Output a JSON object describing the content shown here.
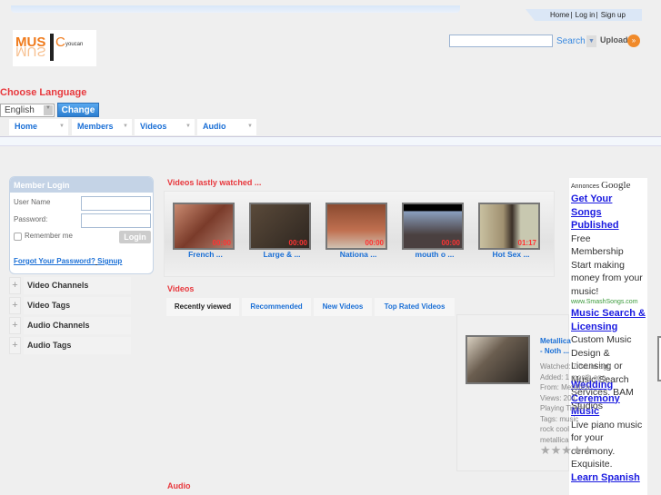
{
  "top_links": [
    "Home",
    "Log in",
    "Sign up"
  ],
  "logo": {
    "text": "MUSIC",
    "sub": "youcan"
  },
  "search": {
    "value": "",
    "button": "Search",
    "upload": "Upload"
  },
  "language": {
    "title": "Choose Language",
    "selected": "English",
    "change": "Change"
  },
  "nav": [
    "Home",
    "Members",
    "Videos",
    "Audio"
  ],
  "login": {
    "title": "Member Login",
    "username": "User Name",
    "password": "Password:",
    "remember": "Remember me",
    "button": "Login",
    "forgot": "Forgot Your Password?",
    "signup": "Signup"
  },
  "sidebar": [
    "Video Channels",
    "Video Tags",
    "Audio Channels",
    "Audio Tags"
  ],
  "recent": {
    "title": "Videos lastly watched ...",
    "items": [
      {
        "title": "French ...",
        "duration": "00:00"
      },
      {
        "title": "Large & ...",
        "duration": "00:00"
      },
      {
        "title": "Nationa ...",
        "duration": "00:00"
      },
      {
        "title": "mouth o ...",
        "duration": "00:00"
      },
      {
        "title": "Hot Sex ...",
        "duration": "01:17"
      }
    ]
  },
  "videos": {
    "title": "Videos",
    "tabs": [
      "Recently viewed",
      "Recommended",
      "New Videos",
      "Top Rated Videos"
    ],
    "active_tab": "Recently viewed",
    "card": {
      "title": "Metallica - Noth ...",
      "watched": "Watched: 7 hours ago",
      "added": "Added: 1 month ago",
      "from": "From: Metallica",
      "views": "Views: 204",
      "playing": "Playing Time: ",
      "tags": "Tags: music rock cool metallica",
      "rating": 0
    }
  },
  "audio": {
    "title": "Audio"
  },
  "ads": {
    "header": "Annonces",
    "brand": "Google",
    "items": [
      {
        "title": "Get Your Songs Published",
        "text": "Free Membership Start making money from your music!",
        "url": "www.SmashSongs.com"
      },
      {
        "title": "Music Search & Licensing",
        "text": "Custom Music Design & Licensing or Music Search Services. BAM Studios"
      },
      {
        "title": "Wedding Ceremony Music",
        "text": "Live piano music for your ceremony. Exquisite. Professional"
      },
      {
        "title": "Learn Spanish"
      }
    ]
  }
}
